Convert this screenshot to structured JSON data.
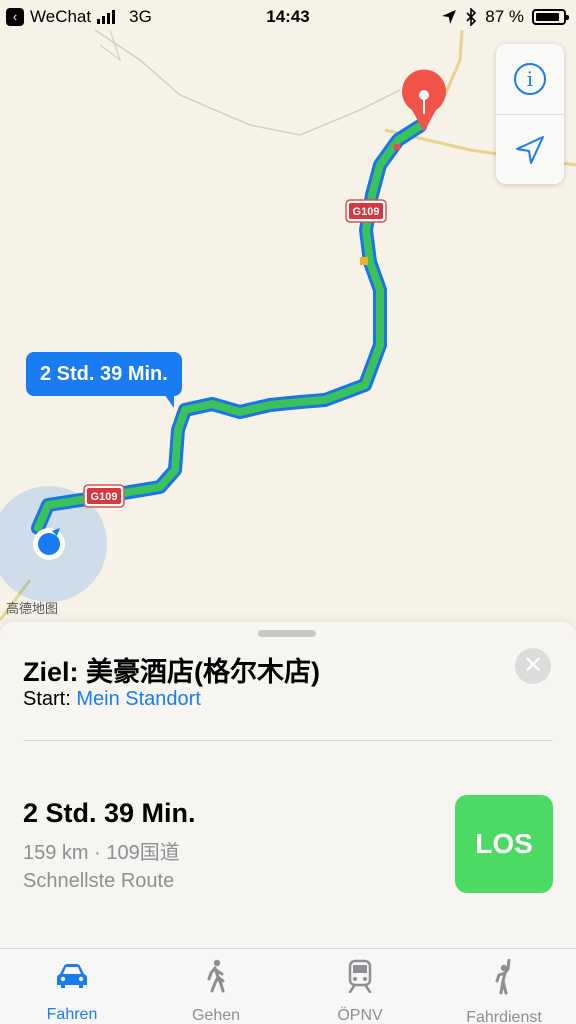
{
  "status_bar": {
    "back_app": "WeChat",
    "network": "3G",
    "time": "14:43",
    "battery": "87 %",
    "battery_level": 0.87
  },
  "map": {
    "eta_label": "2 Std. 39 Min.",
    "road_labels": [
      "G109",
      "G109"
    ],
    "credit": "高德地图"
  },
  "sheet": {
    "destination": "Ziel: 美豪酒店(格尔木店)",
    "start_prefix": "Start: ",
    "start_link": "Mein Standort",
    "route_time": "2 Std. 39 Min.",
    "route_info": "159 km · 109国道",
    "route_desc": "Schnellste Route",
    "go_label": "LOS"
  },
  "tabs": [
    {
      "label": "Fahren",
      "icon": "car-icon",
      "active": true
    },
    {
      "label": "Gehen",
      "icon": "walk-icon",
      "active": false
    },
    {
      "label": "ÖPNV",
      "icon": "train-icon",
      "active": false
    },
    {
      "label": "Fahrdienst",
      "icon": "hail-icon",
      "active": false
    }
  ],
  "colors": {
    "accent": "#1a7cf2",
    "route": "#3cc25a",
    "go": "#4cd964",
    "pin": "#f2544a"
  }
}
